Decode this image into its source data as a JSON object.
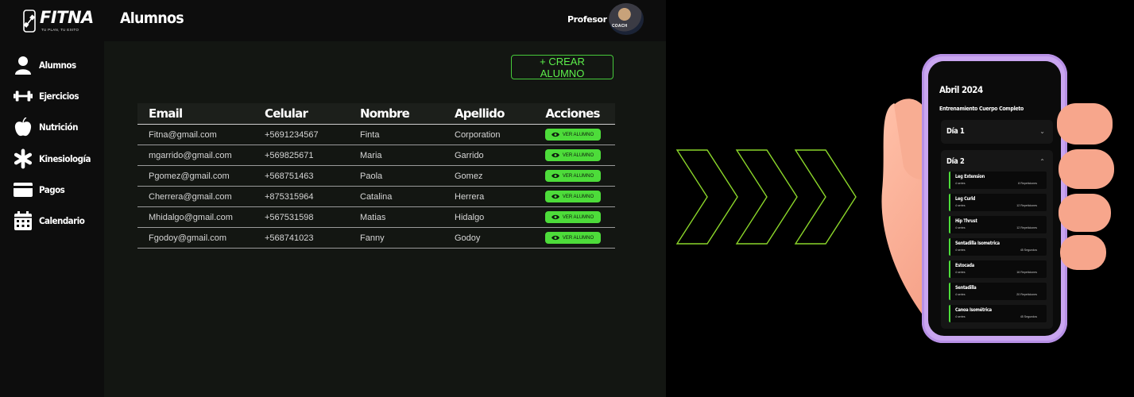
{
  "app": {
    "logo_text": "FITNA",
    "logo_tagline": "TU PLAN, TU EXITO",
    "page_title": "Alumnos",
    "profile_label": "Profesor",
    "avatar_text": "COACH"
  },
  "sidebar": {
    "items": [
      {
        "label": "Alumnos",
        "icon": "user-icon"
      },
      {
        "label": "Ejercicios",
        "icon": "dumbbell-icon"
      },
      {
        "label": "Nutrición",
        "icon": "apple-icon"
      },
      {
        "label": "Kinesiología",
        "icon": "asterisk-icon"
      },
      {
        "label": "Pagos",
        "icon": "credit-card-icon"
      },
      {
        "label": "Calendario",
        "icon": "calendar-icon"
      }
    ]
  },
  "main": {
    "create_button": "+ CREAR ALUMNO",
    "table": {
      "headers": [
        "Email",
        "Celular",
        "Nombre",
        "Apellido",
        "Acciones"
      ],
      "action_label": "VER ALUMNO",
      "rows": [
        {
          "email": "Fitna@gmail.com",
          "phone": "+5691234567",
          "name": "Finta",
          "surname": "Corporation"
        },
        {
          "email": "mgarrido@gmail.com",
          "phone": "+569825671",
          "name": "Maria",
          "surname": "Garrido"
        },
        {
          "email": "Pgomez@gmail.com",
          "phone": "+568751463",
          "name": "Paola",
          "surname": "Gomez"
        },
        {
          "email": "Cherrera@gmail.com",
          "phone": "+875315964",
          "name": "Catalina",
          "surname": "Herrera"
        },
        {
          "email": "Mhidalgo@gmail.com",
          "phone": "+567531598",
          "name": "Matias",
          "surname": "Hidalgo"
        },
        {
          "email": "Fgodoy@gmail.com",
          "phone": "+568741023",
          "name": "Fanny",
          "surname": "Godoy"
        }
      ]
    }
  },
  "colors": {
    "accent": "#4ddc3a",
    "background": "#0d0d0d",
    "phone_frame": "#c9a5f0",
    "skin": "#f4a98f"
  },
  "phone": {
    "month": "Abril 2024",
    "plan_title": "Entrenamiento Cuerpo Completo",
    "days": [
      {
        "label": "Día 1",
        "expanded": false
      },
      {
        "label": "Día 2",
        "expanded": true
      }
    ],
    "exercises": [
      {
        "name": "Leg Extension",
        "sets": "4 series",
        "reps": "8 Repeticiones"
      },
      {
        "name": "Leg Curld",
        "sets": "4 series",
        "reps": "12 Repeticiones"
      },
      {
        "name": "Hip Thrust",
        "sets": "4 series",
        "reps": "12 Repeticiones"
      },
      {
        "name": "Sentadilla Isometrica",
        "sets": "4 series",
        "reps": "45 Segundos"
      },
      {
        "name": "Estocada",
        "sets": "4 series",
        "reps": "16 Repeticiones"
      },
      {
        "name": "Sentadilla",
        "sets": "4 series",
        "reps": "20 Repeticiones"
      },
      {
        "name": "Canoa Isométrica",
        "sets": "4 series",
        "reps": "45 Segundos"
      }
    ]
  }
}
